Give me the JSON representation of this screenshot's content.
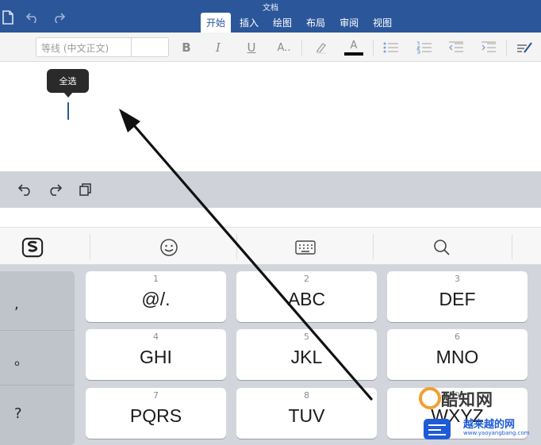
{
  "app": {
    "doc_title": "文档"
  },
  "ribbon": {
    "tabs": [
      "开始",
      "插入",
      "绘图",
      "布局",
      "审阅",
      "视图"
    ],
    "active_tab": "开始"
  },
  "toolbar": {
    "font_name": "等线 (中文正文)",
    "bold_label": "B",
    "italic_label": "I",
    "underline_label": "U",
    "text_effect_label": "A..",
    "font_color_label": "A",
    "font_color": "#000000"
  },
  "document": {
    "popup_label": "全选"
  },
  "keypad": {
    "punctuation": [
      ",",
      "。",
      "?"
    ],
    "keys": [
      {
        "number": "1",
        "letters": "@/."
      },
      {
        "number": "2",
        "letters": "ABC"
      },
      {
        "number": "3",
        "letters": "DEF"
      },
      {
        "number": "4",
        "letters": "GHI"
      },
      {
        "number": "5",
        "letters": "JKL"
      },
      {
        "number": "6",
        "letters": "MNO"
      },
      {
        "number": "7",
        "letters": "PQRS"
      },
      {
        "number": "8",
        "letters": "TUV"
      },
      {
        "number": "9",
        "letters": "WXYZ"
      }
    ]
  },
  "watermark": {
    "name": "酷知网",
    "line2": "越来越的网",
    "url": "www.yaoyangbang.com"
  },
  "colors": {
    "ribbon_blue": "#2b579a",
    "annotation_arrow": "#111111"
  }
}
